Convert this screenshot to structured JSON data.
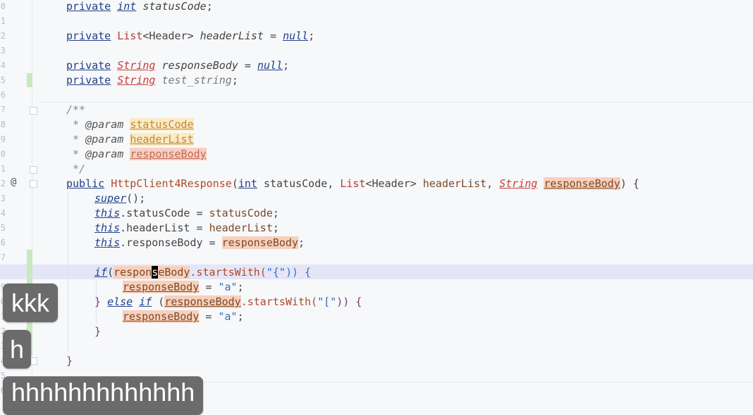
{
  "line_numbers": [
    "0",
    "1",
    "2",
    "3",
    "4",
    "5",
    "6",
    "7",
    "8",
    "9",
    "0",
    "1",
    "2",
    "3",
    "4",
    "5",
    "6",
    "7",
    "8",
    "9",
    "0",
    "1",
    "2",
    "3",
    "4",
    "5",
    "6"
  ],
  "code": {
    "l1": {
      "kw": "private",
      "type": "int",
      "field": "statusCode",
      "end": ";"
    },
    "l2": {
      "kw": "private",
      "type": "List",
      "generic": "<Header>",
      "field": "headerList",
      "eq": " = ",
      "nul": "null",
      "end": ";"
    },
    "l3": {
      "kw": "private",
      "type": "String",
      "field": "responseBody",
      "eq": " = ",
      "nul": "null",
      "end": ";"
    },
    "l4": {
      "kw": "private",
      "type": "String",
      "field": "test_string",
      "end": ";"
    },
    "doc_open": "/**",
    "doc_star": " * ",
    "doc_tag": "@param",
    "doc_p1": "statusCode",
    "doc_p2": "headerList",
    "doc_p3": "responseBody",
    "doc_close": " */",
    "ctor": {
      "kw": "public",
      "name": "HttpClient4Response",
      "open": "(",
      "t1": "int",
      "a1": " statusCode, ",
      "t2": "List",
      "g2": "<Header>",
      "a2": " headerList, ",
      "t3": "String",
      "a3": "responseBody",
      "close": ") {"
    },
    "super": {
      "kw": "super",
      "rest": "();"
    },
    "assign1": {
      "kw": "this",
      "dot": ".statusCode = ",
      "val": "statusCode",
      "end": ";"
    },
    "assign2": {
      "kw": "this",
      "dot": ".headerList = ",
      "val": "headerList",
      "end": ";"
    },
    "assign3": {
      "kw": "this",
      "dot": ".responseBody = ",
      "val": "responseBody",
      "end": ";"
    },
    "if1": {
      "kw": "if",
      "open": "(",
      "pre": "respon",
      "cur": "s",
      "post": "eBody",
      "call": ".startsWith(",
      "str": "\"{\"",
      "close": ")) {"
    },
    "asg_a1": {
      "var": "responseBody",
      "eq": " = ",
      "str": "\"a\"",
      "end": ";"
    },
    "else": {
      "brace": "} ",
      "kw1": "else",
      "kw2": "if",
      "open": " (",
      "var": "responseBody",
      "call": ".startsWith(",
      "str": "\"[\"",
      "close": ")) {"
    },
    "asg_a2": {
      "var": "responseBody",
      "eq": " = ",
      "str": "\"a\"",
      "end": ";"
    },
    "close_inner": "}",
    "close_outer": "}"
  },
  "gutter_icon": "@",
  "bubbles": {
    "b1": "kkk",
    "b2": "h",
    "b3": "hhhhhhhhhhhhh"
  }
}
